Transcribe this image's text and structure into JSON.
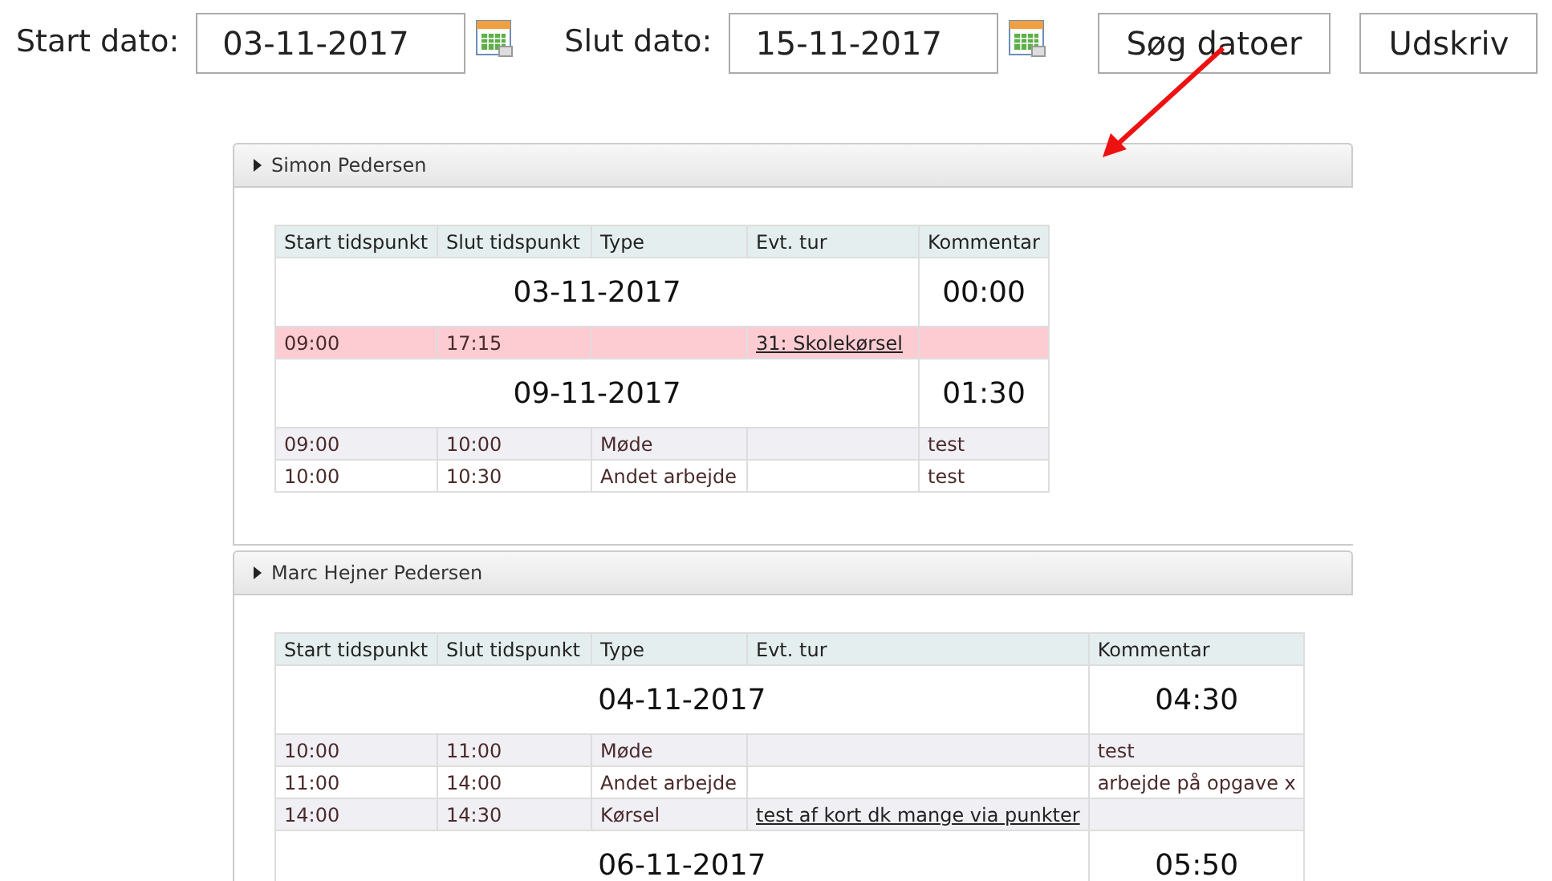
{
  "filter": {
    "start_label": "Start dato:",
    "start_value": "03-11-2017",
    "end_label": "Slut dato:",
    "end_value": "15-11-2017",
    "buttons": [
      "Søg datoer",
      "Udskriv"
    ]
  },
  "panels": [
    {
      "name": "Simon Pedersen",
      "expanded": true,
      "columns": [
        "Start tidspunkt",
        "Slut tidspunkt",
        "Type",
        "Evt. tur",
        "Kommentar"
      ],
      "rows": [
        {
          "kind": "day",
          "date": "03-11-2017",
          "total": "00:00"
        },
        {
          "kind": "entry",
          "flagged": true,
          "start": "09:00",
          "end": "17:15",
          "tur": "31: Skolekørsel"
        },
        {
          "kind": "day",
          "date": "09-11-2017",
          "total": "01:30"
        },
        {
          "kind": "entry",
          "flagged": false,
          "start": "09:00",
          "end": "10:00",
          "type": "Møde",
          "comment": "test"
        },
        {
          "kind": "entry",
          "flagged": false,
          "start": "10:00",
          "end": "10:30",
          "type": "Andet arbejde",
          "comment": "test"
        }
      ]
    },
    {
      "name": "Marc Hejner Pedersen",
      "expanded": true,
      "columns": [
        "Start tidspunkt",
        "Slut tidspunkt",
        "Type",
        "Evt. tur",
        "Kommentar"
      ],
      "rows": [
        {
          "kind": "day",
          "date": "04-11-2017",
          "total": "04:30"
        },
        {
          "kind": "entry",
          "flagged": false,
          "start": "10:00",
          "end": "11:00",
          "type": "Møde",
          "comment": "test"
        },
        {
          "kind": "entry",
          "flagged": false,
          "start": "11:00",
          "end": "14:00",
          "type": "Andet arbejde",
          "comment": "arbejde på opgave x"
        },
        {
          "kind": "entry",
          "flagged": false,
          "start": "14:00",
          "end": "14:30",
          "type": "Kørsel",
          "tur": "test af kort dk mange via punkter"
        },
        {
          "kind": "day",
          "date": "06-11-2017",
          "total": "05:50"
        }
      ]
    }
  ]
}
